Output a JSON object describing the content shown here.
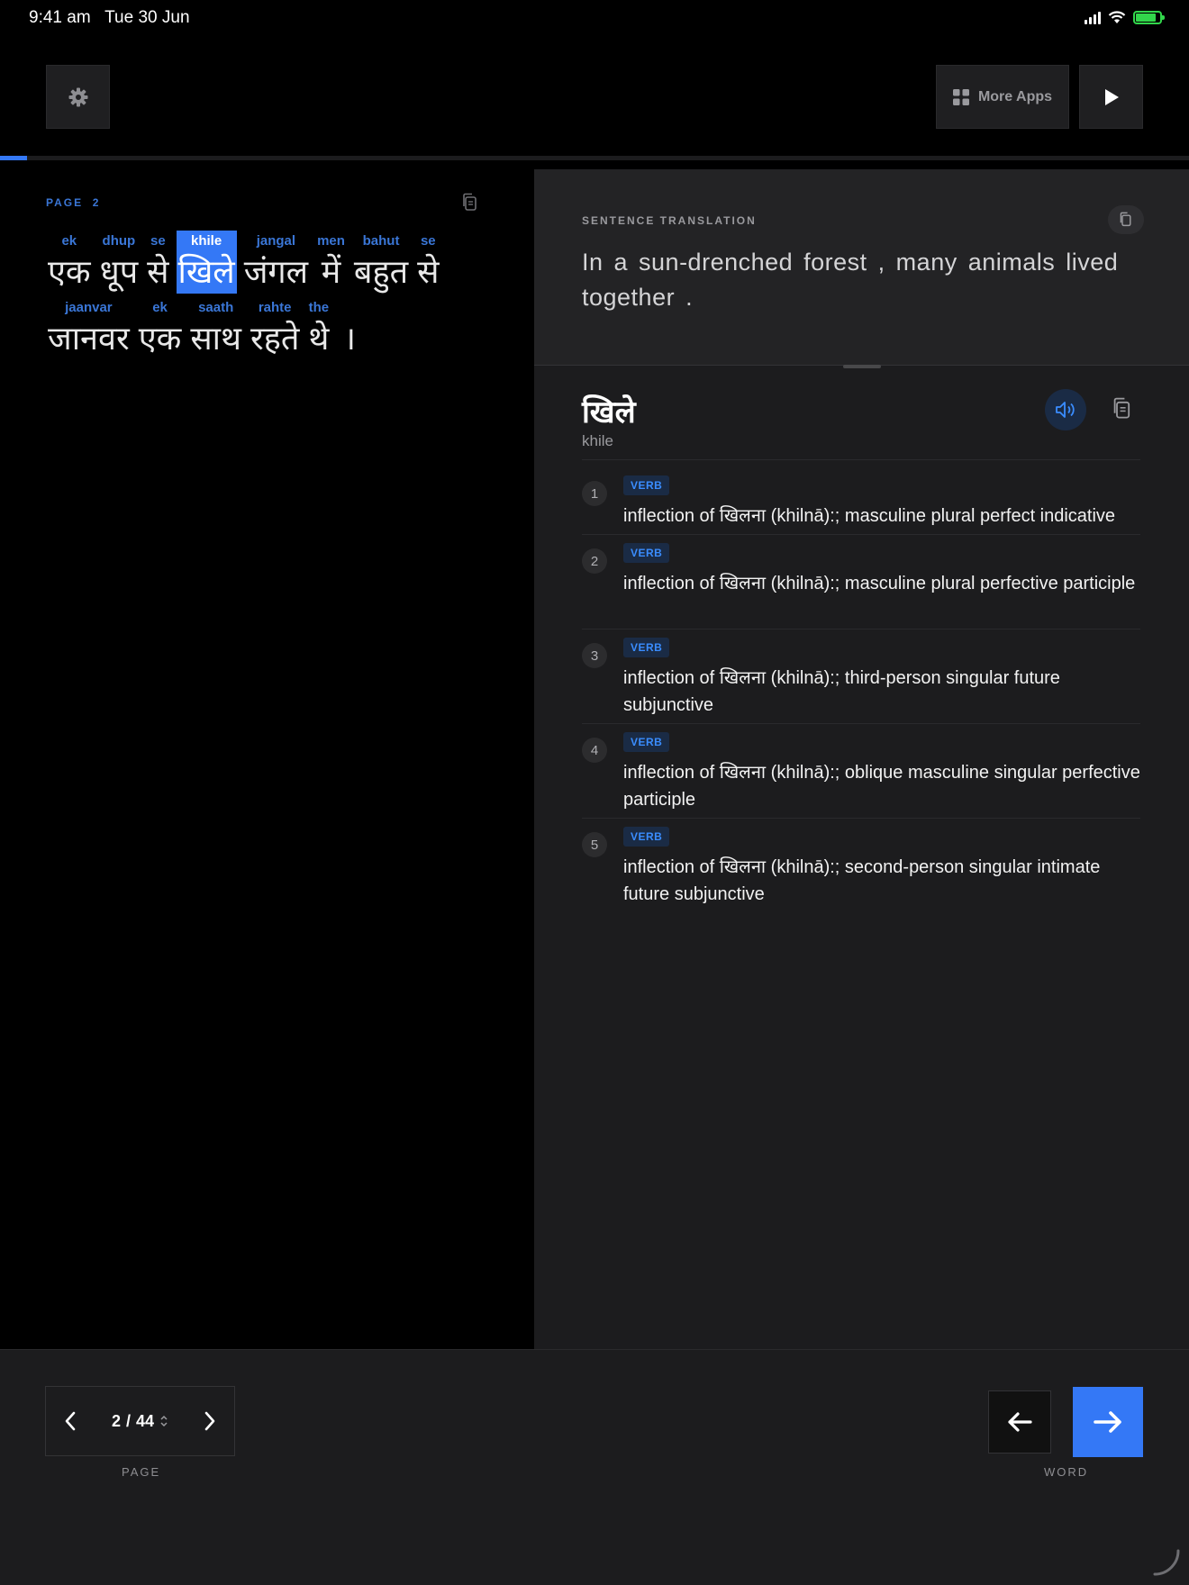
{
  "status_bar": {
    "time": "9:41 am",
    "date": "Tue 30 Jun"
  },
  "toolbar": {
    "more_apps_label": "More Apps"
  },
  "reader": {
    "page_label": "PAGE",
    "page_number": "2",
    "progress_fraction": 0.023,
    "line1": [
      {
        "translit": "ek",
        "hindi": "एक"
      },
      {
        "translit": "dhup",
        "hindi": "धूप"
      },
      {
        "translit": "se",
        "hindi": "से"
      },
      {
        "translit": "khile",
        "hindi": "खिले",
        "selected": true
      },
      {
        "translit": "jangal",
        "hindi": "जंगल"
      },
      {
        "translit": "men",
        "hindi": "में"
      },
      {
        "translit": "bahut",
        "hindi": "बहुत"
      },
      {
        "translit": "se",
        "hindi": "से"
      }
    ],
    "line2": [
      {
        "translit": "jaanvar",
        "hindi": "जानवर"
      },
      {
        "translit": "ek",
        "hindi": "एक"
      },
      {
        "translit": "saath",
        "hindi": "साथ"
      },
      {
        "translit": "rahte",
        "hindi": "रहते"
      },
      {
        "translit": "the",
        "hindi": "थे"
      }
    ],
    "line2_punct": "।"
  },
  "translation": {
    "label": "SENTENCE TRANSLATION",
    "text": "In a sun-drenched forest , many animals lived together ."
  },
  "word_detail": {
    "headword": "खिले",
    "translit": "khile",
    "definitions": [
      {
        "num": "1",
        "pos": "VERB",
        "text": "inflection of खिलना (khilnā):; masculine plural perfect indicative"
      },
      {
        "num": "2",
        "pos": "VERB",
        "text": "inflection of खिलना (khilnā):; masculine plural perfective participle"
      },
      {
        "num": "3",
        "pos": "VERB",
        "text": "inflection of खिलना (khilnā):; third-person singular future subjunctive"
      },
      {
        "num": "4",
        "pos": "VERB",
        "text": "inflection of खिलना (khilnā):; oblique masculine singular perfective participle"
      },
      {
        "num": "5",
        "pos": "VERB",
        "text": "inflection of खिलना (khilnā):; second-person singular intimate future subjunctive"
      }
    ]
  },
  "bottom": {
    "page_current": "2",
    "page_separator": "/",
    "page_total": "44",
    "page_label": "PAGE",
    "word_label": "WORD"
  },
  "colors": {
    "accent": "#3478f6",
    "panel": "#1c1c1e",
    "pos_badge": "#1a2b45"
  }
}
